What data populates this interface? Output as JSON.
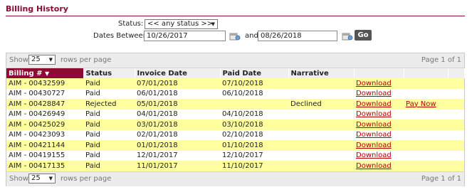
{
  "page": {
    "title": "Billing History"
  },
  "filters": {
    "status_label": "Status:",
    "status_value": "<< any status >>",
    "dates_label": "Dates Between:",
    "date_from": "10/26/2017",
    "and_label": "and",
    "date_to": "08/26/2018",
    "go_label": "Go"
  },
  "pager": {
    "show_label": "Show",
    "page_size": "25",
    "rows_per_page": "rows per page",
    "page_info": "Page 1 of 1"
  },
  "table": {
    "columns": [
      "Billing #",
      "Status",
      "Invoice Date",
      "Paid Date",
      "Narrative",
      "",
      ""
    ],
    "sort_indicator": "▼",
    "rows": [
      {
        "billing": "AIM - 00432599",
        "status": "Paid",
        "invoice": "07/01/2018",
        "paid": "07/10/2018",
        "narrative": "",
        "download": "Download",
        "action": ""
      },
      {
        "billing": "AIM - 00430727",
        "status": "Paid",
        "invoice": "06/01/2018",
        "paid": "06/10/2018",
        "narrative": "",
        "download": "Download",
        "action": ""
      },
      {
        "billing": "AIM - 00428847",
        "status": "Rejected",
        "invoice": "05/01/2018",
        "paid": "",
        "narrative": "Declined",
        "download": "Download",
        "action": "Pay Now"
      },
      {
        "billing": "AIM - 00426949",
        "status": "Paid",
        "invoice": "04/01/2018",
        "paid": "04/10/2018",
        "narrative": "",
        "download": "Download",
        "action": ""
      },
      {
        "billing": "AIM - 00425029",
        "status": "Paid",
        "invoice": "03/01/2018",
        "paid": "03/10/2018",
        "narrative": "",
        "download": "Download",
        "action": ""
      },
      {
        "billing": "AIM - 00423093",
        "status": "Paid",
        "invoice": "02/01/2018",
        "paid": "02/10/2018",
        "narrative": "",
        "download": "Download",
        "action": ""
      },
      {
        "billing": "AIM - 00421144",
        "status": "Paid",
        "invoice": "01/01/2018",
        "paid": "01/10/2018",
        "narrative": "",
        "download": "Download",
        "action": ""
      },
      {
        "billing": "AIM - 00419155",
        "status": "Paid",
        "invoice": "12/01/2017",
        "paid": "12/10/2017",
        "narrative": "",
        "download": "Download",
        "action": ""
      },
      {
        "billing": "AIM - 00417135",
        "status": "Paid",
        "invoice": "11/01/2017",
        "paid": "11/10/2017",
        "narrative": "",
        "download": "Download",
        "action": ""
      }
    ]
  },
  "icons": {
    "calendar": "calendar-icon",
    "dropdown": "chevron-down-icon",
    "sort": "sort-desc-icon"
  },
  "colors": {
    "brand": "#8c0b30",
    "row_highlight": "#ffffa0",
    "link": "#b30000",
    "button": "#555555"
  }
}
